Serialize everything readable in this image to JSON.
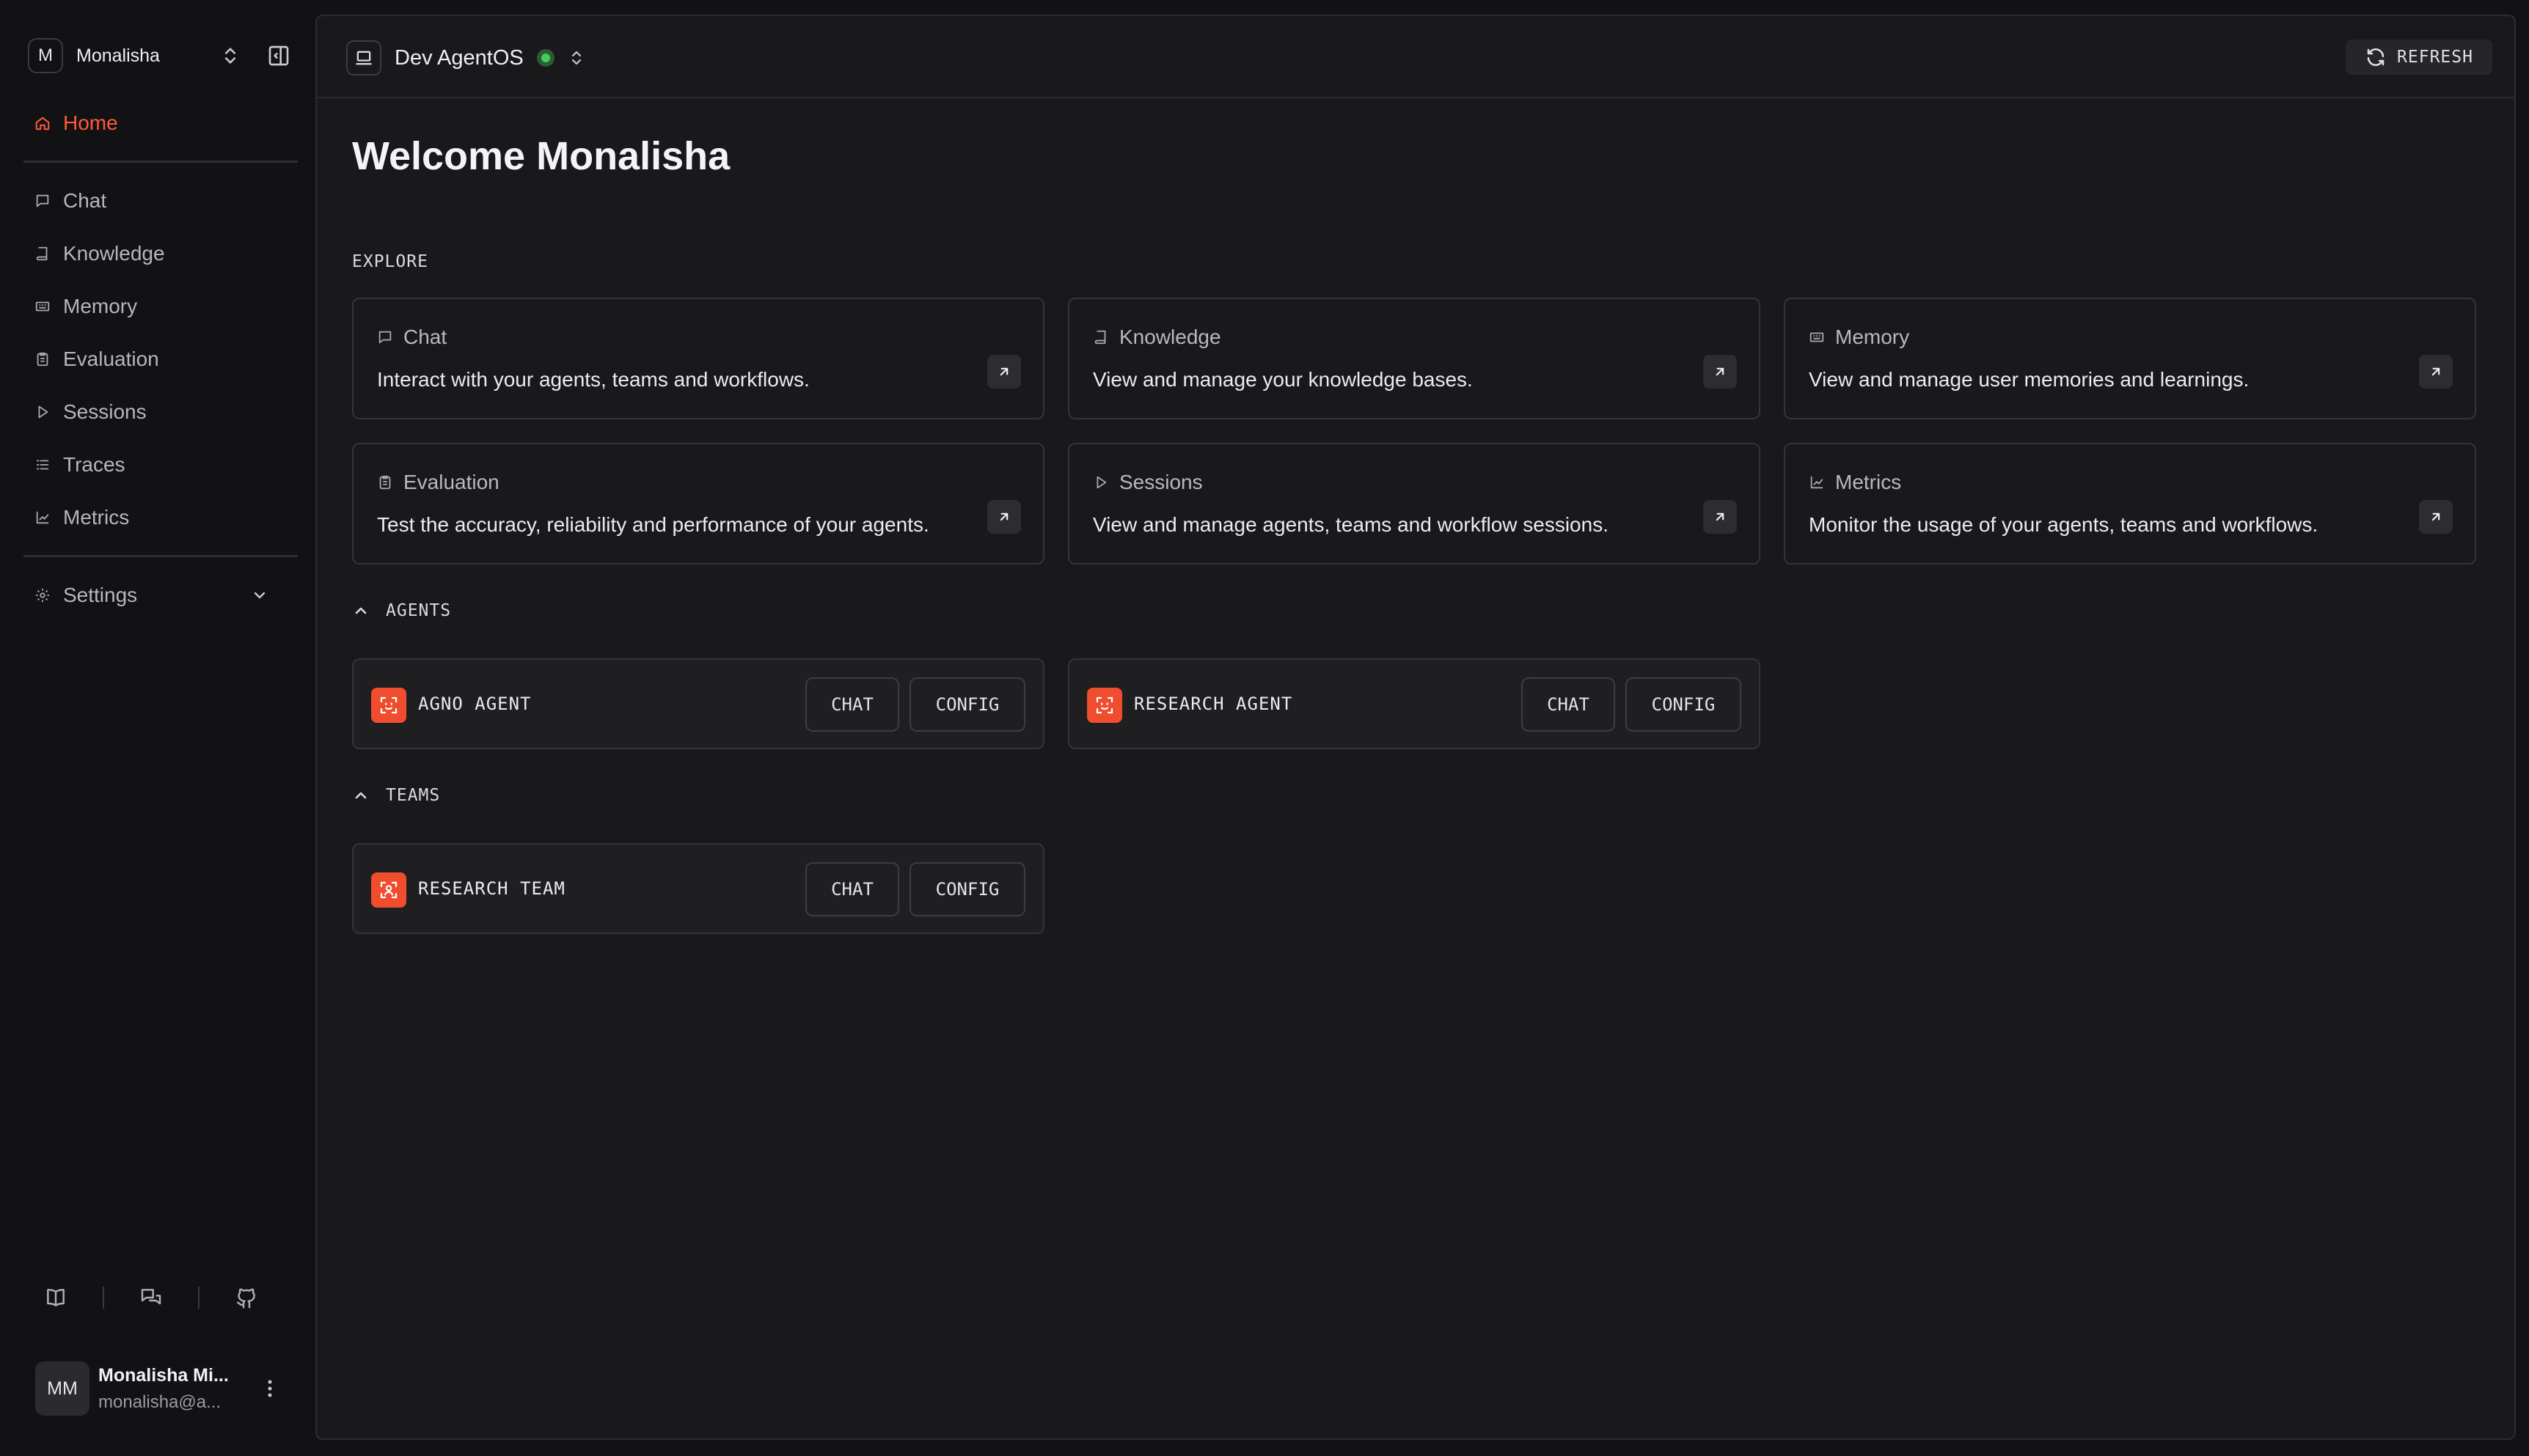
{
  "workspace": {
    "initial": "M",
    "name": "Monalisha"
  },
  "nav": {
    "home": "Home",
    "items": [
      "Chat",
      "Knowledge",
      "Memory",
      "Evaluation",
      "Sessions",
      "Traces",
      "Metrics"
    ],
    "settings": "Settings"
  },
  "user": {
    "initials": "MM",
    "name": "Monalisha Mi...",
    "email": "monalisha@a..."
  },
  "topbar": {
    "environment": "Dev AgentOS",
    "status": "online",
    "refresh_label": "REFRESH"
  },
  "welcome": "Welcome Monalisha",
  "explore": {
    "label": "EXPLORE",
    "cards": [
      {
        "title": "Chat",
        "icon": "chat-icon",
        "desc": "Interact with your agents, teams and workflows."
      },
      {
        "title": "Knowledge",
        "icon": "book-icon",
        "desc": "View and manage your knowledge bases."
      },
      {
        "title": "Memory",
        "icon": "memory-icon",
        "desc": "View and manage user memories and learnings."
      },
      {
        "title": "Evaluation",
        "icon": "clipboard-icon",
        "desc": "Test the accuracy, reliability and performance of your agents."
      },
      {
        "title": "Sessions",
        "icon": "play-icon",
        "desc": "View and manage agents, teams and workflow sessions."
      },
      {
        "title": "Metrics",
        "icon": "chart-icon",
        "desc": "Monitor the usage of your agents, teams and workflows."
      }
    ]
  },
  "agents": {
    "label": "AGENTS",
    "items": [
      {
        "name": "AGNO AGENT",
        "chat": "CHAT",
        "config": "CONFIG"
      },
      {
        "name": "RESEARCH AGENT",
        "chat": "CHAT",
        "config": "CONFIG"
      }
    ]
  },
  "teams": {
    "label": "TEAMS",
    "items": [
      {
        "name": "RESEARCH TEAM",
        "chat": "CHAT",
        "config": "CONFIG"
      }
    ]
  },
  "colors": {
    "accent": "#ff5a3c",
    "status_online": "#3ecf5a",
    "entity_logo": "#ef4d2e"
  }
}
